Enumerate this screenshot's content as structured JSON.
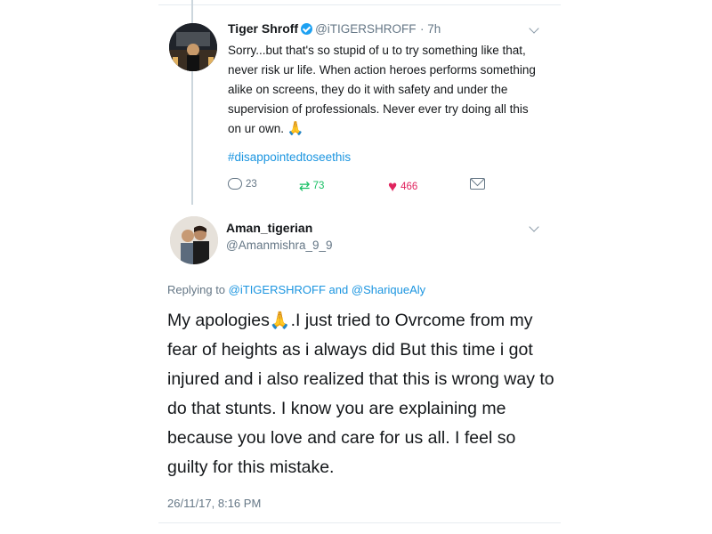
{
  "tweet1": {
    "name": "Tiger Shroff",
    "handle": "@iTIGERSHROFF",
    "time": "· 7h",
    "text": "Sorry...but that's so stupid of u to try something like that, never risk ur life. When action heroes performs something alike on screens, they do it with safety and under the supervision of professionals. Never ever try doing all this on ur own.",
    "emoji": "🙏",
    "hashtag": "#disappointedtoseethis",
    "actions": {
      "replies": "23",
      "retweets": "73",
      "likes": "466"
    },
    "icons": [
      "verified-badge-icon",
      "chevron-down-icon",
      "reply-icon",
      "retweet-icon",
      "heart-icon",
      "direct-message-icon"
    ],
    "colors": {
      "hashtag": "#1b95e0",
      "retweet": "#17bf63",
      "like": "#e0245e",
      "verified": "#1da1f2"
    }
  },
  "tweet2": {
    "name": "Aman_tigerian",
    "handle": "@Amanmishra_9_9",
    "replying_prefix": "Replying to",
    "mention1": "@iTIGERSHROFF",
    "and": "and",
    "mention2": "@ShariqueAly",
    "text_prefix": "My apologies",
    "emoji": "🙏",
    "text_rest": ".I just tried to Ovrcome from my fear of heights as i always did But this time i got injured and i also realized that this is wrong  way to do that stunts. I know you are explaining me because you love and care for us all. I feel so guilty for this mistake.",
    "timestamp": "26/11/17, 8:16 PM"
  }
}
